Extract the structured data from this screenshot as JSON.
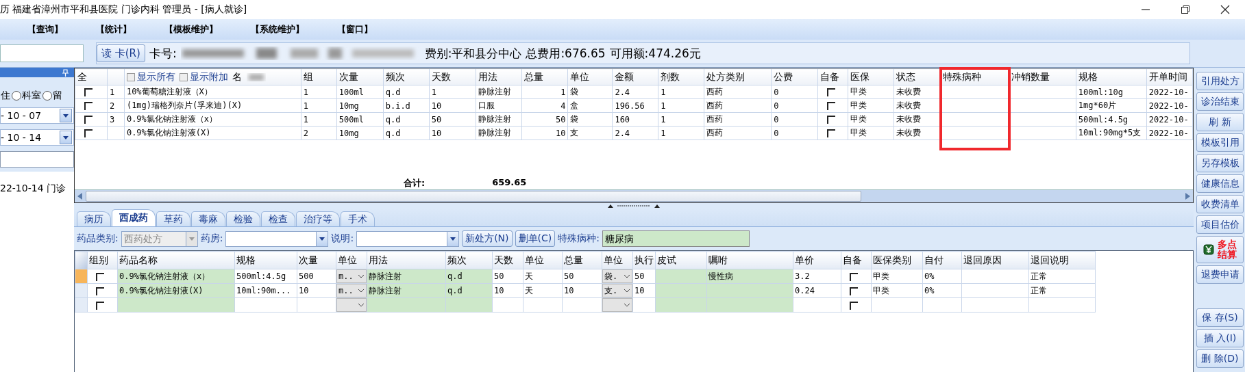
{
  "window": {
    "title": "历  福建省漳州市平和县医院  门诊内科  管理员 - [病人就诊]"
  },
  "menu": [
    "【查询】",
    "【统计】",
    "【模板维护】",
    "【系统维护】",
    "【窗口】"
  ],
  "toolbar": {
    "read_card_button": "读 卡(R)",
    "card_label": "卡号:",
    "fee_type": "费别:平和县分中心",
    "total": "总费用:676.65",
    "available": "可用额:474.26元"
  },
  "left_panel": {
    "radio_fragment": "住",
    "radios": [
      {
        "label": "科室",
        "selected": false
      },
      {
        "label": "留",
        "selected": false
      }
    ],
    "dates": [
      "- 10 - 07",
      "- 10 - 14"
    ],
    "visits": [
      "22-10-14 门诊"
    ]
  },
  "orders": {
    "show_all": {
      "label": "显示所有",
      "checked": false
    },
    "show_extra": {
      "label": "显示附加",
      "checked": false
    },
    "columns": [
      {
        "label": "全",
        "kind": "check"
      },
      {
        "kind": "text"
      },
      {
        "label": "名",
        "kind": "text"
      },
      {
        "label": "组",
        "kind": "text"
      },
      {
        "label": "次量",
        "kind": "text"
      },
      {
        "label": "频次",
        "kind": "text"
      },
      {
        "label": "天数",
        "kind": "text"
      },
      {
        "label": "用法",
        "kind": "text"
      },
      {
        "label": "总量",
        "kind": "num"
      },
      {
        "label": "单位",
        "kind": "text"
      },
      {
        "label": "金额",
        "kind": "text"
      },
      {
        "label": "剂数",
        "kind": "text"
      },
      {
        "label": "处方类别",
        "kind": "text"
      },
      {
        "label": "公费",
        "kind": "text"
      },
      {
        "label": "自备",
        "kind": "check"
      },
      {
        "label": "医保",
        "kind": "text"
      },
      {
        "label": "状态",
        "kind": "text"
      },
      {
        "label": "特殊病种",
        "kind": "text",
        "highlighted": true
      },
      {
        "label": "冲销数量",
        "kind": "text"
      },
      {
        "label": "规格",
        "kind": "text"
      },
      {
        "label": "开单时间",
        "kind": "text"
      }
    ],
    "rows": [
      {
        "cells": [
          false,
          "1",
          "10%葡萄糖注射液（X）",
          "1",
          "100ml",
          "q.d",
          "1",
          "静脉注射",
          "1",
          "袋",
          "2.4",
          "1",
          "西药",
          "0",
          false,
          "甲类",
          "未收费",
          null,
          null,
          "100ml:10g",
          "2022-10-"
        ]
      },
      {
        "cells": [
          false,
          "2",
          "(1mg)瑞格列奈片(孚来迪)(X)",
          "1",
          "10mg",
          "b.i.d",
          "10",
          "口服",
          "4",
          "盒",
          "196.56",
          "1",
          "西药",
          "0",
          false,
          "甲类",
          "未收费",
          null,
          null,
          "1mg*60片",
          "2022-10-"
        ]
      },
      {
        "cells": [
          false,
          "3",
          "0.9%氯化钠注射液（x）",
          "1",
          "500ml",
          "q.d",
          "50",
          "静脉注射",
          "50",
          "袋",
          "160",
          "1",
          "西药",
          "0",
          false,
          "甲类",
          "未收费",
          null,
          null,
          "500ml:4.5g",
          "2022-10-"
        ]
      },
      {
        "cells": [
          false,
          null,
          "0.9%氯化钠注射液(X)",
          "2",
          "10mg",
          "q.d",
          "10",
          "静脉注射",
          "10",
          "支",
          "2.4",
          "1",
          "西药",
          "0",
          false,
          "甲类",
          "未收费",
          null,
          null,
          "10ml:90mg*5支",
          "2022-10-"
        ]
      }
    ],
    "total_label": "合计:",
    "total": "659.65"
  },
  "tabs": [
    {
      "label": "病历",
      "selected": false
    },
    {
      "label": "西成药",
      "selected": true
    },
    {
      "label": "草药",
      "selected": false
    },
    {
      "label": "毒麻",
      "selected": false
    },
    {
      "label": "检验",
      "selected": false
    },
    {
      "label": "检查",
      "selected": false
    },
    {
      "label": "治疗等",
      "selected": false
    },
    {
      "label": "手术",
      "selected": false
    }
  ],
  "filter": {
    "category_label": "药品类别:",
    "category_value": "西药处方",
    "category_disabled": true,
    "pharmacy_label": "药房:",
    "note_label": "说明:",
    "buttons": [
      "新处方(N)",
      "删单(C)"
    ],
    "disease_label": "特殊病种:",
    "disease_value": "糖尿病"
  },
  "prescription": {
    "columns": [
      {
        "label": "组别",
        "kind": "check"
      },
      {
        "label": "药品名称",
        "kind": "green"
      },
      {
        "label": "规格",
        "kind": "text"
      },
      {
        "label": "次量",
        "kind": "text"
      },
      {
        "label": "单位",
        "kind": "dropdown"
      },
      {
        "label": "用法",
        "kind": "green"
      },
      {
        "label": "频次",
        "kind": "green"
      },
      {
        "label": "天数",
        "kind": "text"
      },
      {
        "label": "单位",
        "kind": "text"
      },
      {
        "label": "总量",
        "kind": "text"
      },
      {
        "label": "单位",
        "kind": "dropdown"
      },
      {
        "label": "执行",
        "kind": "text"
      },
      {
        "label": "皮试",
        "kind": "green"
      },
      {
        "label": "嘱咐",
        "kind": "green"
      },
      {
        "label": "单价",
        "kind": "text"
      },
      {
        "label": "自备",
        "kind": "check"
      },
      {
        "label": "医保类别",
        "kind": "text"
      },
      {
        "label": "自付",
        "kind": "text"
      },
      {
        "label": "退回原因",
        "kind": "text"
      },
      {
        "label": "退回说明",
        "kind": "text"
      }
    ],
    "rows": [
      {
        "selected": true,
        "cells": [
          false,
          "0.9%氯化钠注射液（x）",
          "500ml:4.5g",
          "500",
          "m..",
          "静脉注射",
          "q.d",
          "50",
          "天",
          "50",
          "袋.",
          "50",
          null,
          "慢性病",
          "3.2",
          false,
          "甲类",
          "0%",
          null,
          "正常"
        ]
      },
      {
        "selected": false,
        "cells": [
          false,
          "0.9%氯化钠注射液(X)",
          "10ml:90m...",
          "10",
          "m..",
          "静脉注射",
          "q.d",
          "10",
          "天",
          "10",
          "支.",
          "10",
          null,
          null,
          "0.24",
          false,
          "甲类",
          "0%",
          null,
          "正常"
        ]
      },
      {
        "selected": false,
        "cells": [
          false,
          null,
          null,
          null,
          null,
          null,
          null,
          null,
          null,
          null,
          null,
          null,
          null,
          null,
          null,
          false,
          null,
          null,
          null,
          null
        ]
      }
    ]
  },
  "side_buttons": [
    {
      "label": "引用处方",
      "kind": "plain"
    },
    {
      "label": "诊治结束",
      "kind": "plain"
    },
    {
      "label": "刷 新",
      "kind": "plain"
    },
    {
      "label": "模板引用",
      "kind": "plain"
    },
    {
      "label": "另存模板",
      "kind": "plain"
    },
    {
      "label": "健康信息",
      "kind": "plain"
    },
    {
      "label": "收费清单",
      "kind": "plain"
    },
    {
      "label": "项目估价",
      "kind": "plain"
    },
    {
      "label": "多点结算",
      "kind": "settle"
    },
    {
      "label": "退费申请",
      "kind": "plain"
    }
  ],
  "side_actions": [
    "保 存(S)",
    "插 入(I)",
    "删 除(D)"
  ]
}
